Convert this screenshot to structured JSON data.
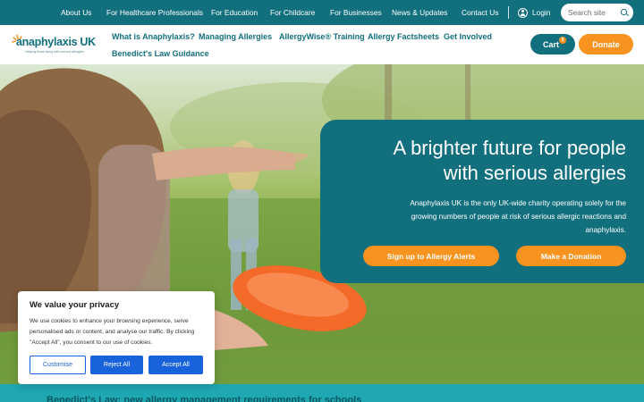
{
  "topbar": {
    "links": [
      "About Us",
      "For Healthcare Professionals",
      "For Education",
      "For Childcare",
      "For Businesses",
      "News & Updates",
      "Contact Us"
    ],
    "login_label": "Login",
    "search_placeholder": "Search site"
  },
  "header": {
    "logo_text": "anaphylaxis UK",
    "logo_tagline": "Helping those living with serious allergies",
    "nav": [
      "What is Anaphylaxis?",
      "Managing Allergies",
      "AllergyWise® Training",
      "Allergy Factsheets",
      "Get Involved",
      "Benedict's Law Guidance"
    ],
    "cart_label": "Cart",
    "cart_count": "0",
    "donate_label": "Donate"
  },
  "hero": {
    "title_line1": "A brighter future for people",
    "title_line2": "with serious allergies",
    "description": "Anaphylaxis UK is the only UK-wide charity operating solely for the growing numbers of people at risk of serious allergic reactions and anaphylaxis.",
    "button_alerts": "Sign up to Allergy Alerts",
    "button_donation": "Make a Donation"
  },
  "band": {
    "text": "Benedict's Law: new allergy management requirements for schools"
  },
  "cookie": {
    "title": "We value your privacy",
    "text": "We use cookies to enhance your browsing experience, serve personalised ads or content, and analyse our traffic. By clicking \"Accept All\", you consent to our use of cookies.",
    "customise_label": "Customise",
    "reject_label": "Reject All",
    "accept_label": "Accept All"
  },
  "colors": {
    "brand_teal": "#126f7d",
    "accent_orange": "#f7931e",
    "band_teal": "#1fa7b2",
    "cookie_blue": "#1863dc"
  }
}
